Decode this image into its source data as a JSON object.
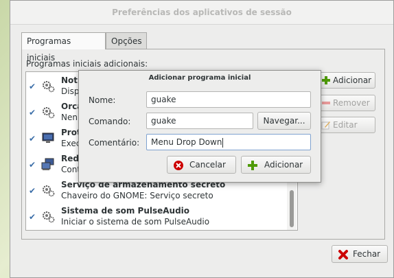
{
  "window": {
    "title": "Preferências dos aplicativos de sessão"
  },
  "tabs": [
    {
      "label": "Programas iniciais"
    },
    {
      "label": "Opções"
    }
  ],
  "section_label": "Programas iniciais adicionais:",
  "startup_items": [
    {
      "title": "Noti",
      "desc": "Disp",
      "enabled": true,
      "icon": "gears-icon"
    },
    {
      "title": "Orca",
      "desc": "Nenl",
      "enabled": true,
      "icon": "gears-icon"
    },
    {
      "title": "Prot",
      "desc": "Exec",
      "enabled": true,
      "icon": "monitor-icon"
    },
    {
      "title": "Rede",
      "desc": "Cont",
      "enabled": true,
      "icon": "network-icon"
    },
    {
      "title": "Serviço de armazenamento secreto",
      "desc": "Chaveiro do GNOME: Serviço secreto",
      "enabled": true,
      "icon": "gears-icon"
    },
    {
      "title": "Sistema de som PulseAudio",
      "desc": "Iniciar o sistema de som PulseAudio",
      "enabled": true,
      "icon": "gears-icon"
    }
  ],
  "side_buttons": {
    "add": "Adicionar",
    "remove": "Remover",
    "edit": "Editar"
  },
  "close_label": "Fechar",
  "dialog": {
    "title": "Adicionar programa inicial",
    "name_label": "Nome:",
    "name_value": "guake",
    "command_label": "Comando:",
    "command_value": "guake",
    "browse_label": "Navegar...",
    "comment_label": "Comentário:",
    "comment_value": "Menu Drop Down",
    "cancel_label": "Cancelar",
    "add_label": "Adicionar"
  },
  "colors": {
    "accent": "#3b6ea8",
    "add_green": "#4e9a06",
    "cancel_red": "#cc0000"
  }
}
